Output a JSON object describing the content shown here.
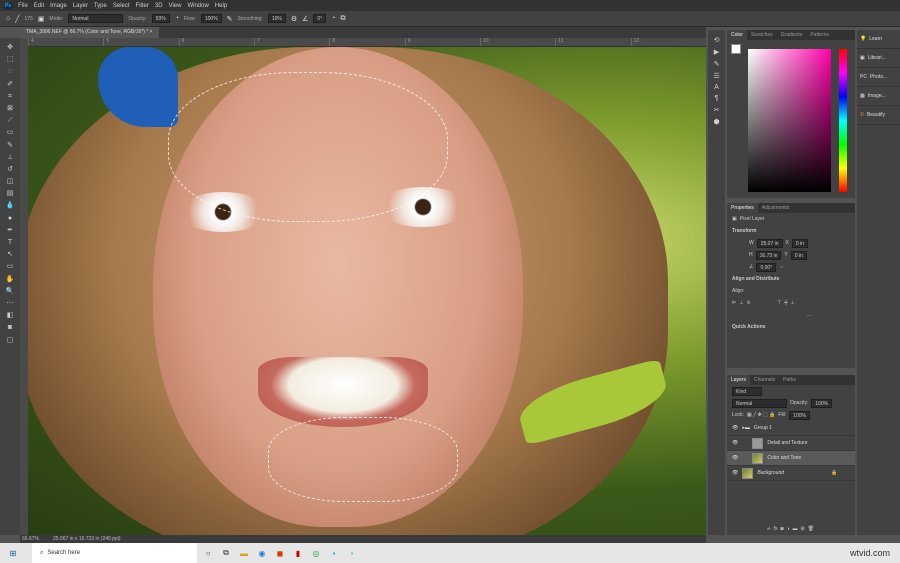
{
  "menubar": {
    "items": [
      "File",
      "Edit",
      "Image",
      "Layer",
      "Type",
      "Select",
      "Filter",
      "3D",
      "View",
      "Window",
      "Help"
    ],
    "app": "Ps"
  },
  "options": {
    "brush_size": "175",
    "mode_label": "Mode:",
    "mode": "Normal",
    "opacity_label": "Opacity:",
    "opacity": "50%",
    "flow_label": "Flow:",
    "flow": "100%",
    "smoothing_label": "Smoothing:",
    "smoothing": "10%",
    "angle": "0°"
  },
  "document_tab": {
    "title": "TMA_3996.NEF @ 66.7% (Color and Tone, RGB/16*) *",
    "close": "×"
  },
  "ruler": {
    "marks": [
      "4",
      "5",
      "6",
      "7",
      "8",
      "9",
      "10",
      "11",
      "12"
    ]
  },
  "statusbar": {
    "zoom": "66.67%",
    "doc_size": "25.067 in x 16.733 in (240 ppi)"
  },
  "color_panel": {
    "tabs": [
      "Color",
      "Swatches",
      "Gradients",
      "Patterns"
    ]
  },
  "right_panel": {
    "items": [
      "Learn",
      "Librari...",
      "Photo...",
      "Image...",
      "Beautify"
    ]
  },
  "properties": {
    "tabs": [
      "Properties",
      "Adjustments"
    ],
    "type": "Pixel Layer",
    "transform_label": "Transform",
    "w_label": "W",
    "w": "25.07 in",
    "h_label": "H",
    "h": "16.73 in",
    "x_label": "X",
    "x": "0 in",
    "y_label": "Y",
    "y": "0 in",
    "angle": "0.00°",
    "align_label": "Align and Distribute",
    "align_sub": "Align:",
    "more": "...",
    "quick_actions": "Quick Actions"
  },
  "layers": {
    "tabs": [
      "Layers",
      "Channels",
      "Paths"
    ],
    "filter": "Kind",
    "blend": "Normal",
    "opacity_label": "Opacity:",
    "opacity": "100%",
    "lock_label": "Lock:",
    "fill_label": "Fill:",
    "fill": "100%",
    "items": [
      {
        "name": "Group 1"
      },
      {
        "name": "Detail and Texture"
      },
      {
        "name": "Color and Tone"
      },
      {
        "name": "Background"
      }
    ]
  },
  "taskbar": {
    "search_placeholder": "Search here",
    "watermark": "wtvid.com"
  }
}
